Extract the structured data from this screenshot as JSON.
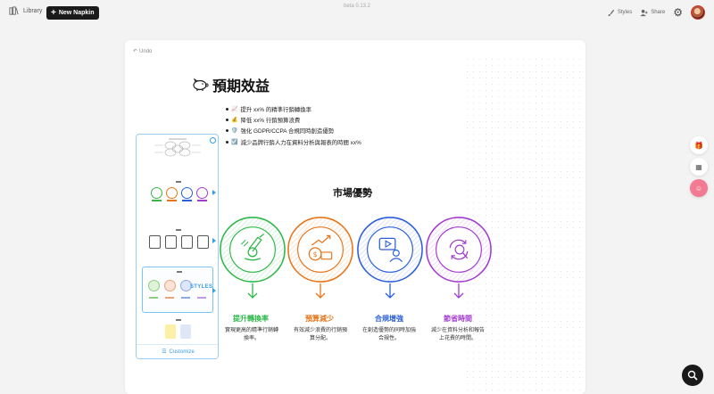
{
  "topbar": {
    "library_label": "Library",
    "new_napkin_label": "New Napkin",
    "version": "beta 0.13.2",
    "styles_label": "Styles",
    "share_label": "Share"
  },
  "canvas": {
    "undo_label": "Undo",
    "title": "預期效益",
    "bullets": [
      {
        "emoji": "📈",
        "text": "提升 xx% 的精準行銷轉換率"
      },
      {
        "emoji": "💰",
        "text": "降低 xx% 行銷預算浪費"
      },
      {
        "emoji": "🛡️",
        "text": "強化 GDPR/CCPA 合規同時創造優勢"
      },
      {
        "emoji": "☑️",
        "text": "減少品牌行銷人力在資料分析與報表的時間 xx%"
      }
    ],
    "market_title": "市場優勢",
    "columns": [
      {
        "label": "提升轉換率",
        "desc": "實現更高的精準行銷轉換率。",
        "color": "#2fb84a"
      },
      {
        "label": "預算減少",
        "desc": "有效減少浪費的行銷預算分配。",
        "color": "#e8751a"
      },
      {
        "label": "合規增強",
        "desc": "在創造優勢的同時加強合規性。",
        "color": "#2b5fd9"
      },
      {
        "label": "節省時間",
        "desc": "減少在資料分析和報告上花費的時間。",
        "color": "#a33bd0"
      }
    ]
  },
  "picker": {
    "styles_tag": "STYLES",
    "customize_label": "Customize"
  },
  "colors": {
    "accent": "#3a9be0",
    "green": "#2fb84a",
    "orange": "#e8751a",
    "blue": "#2b5fd9",
    "purple": "#a33bd0"
  }
}
